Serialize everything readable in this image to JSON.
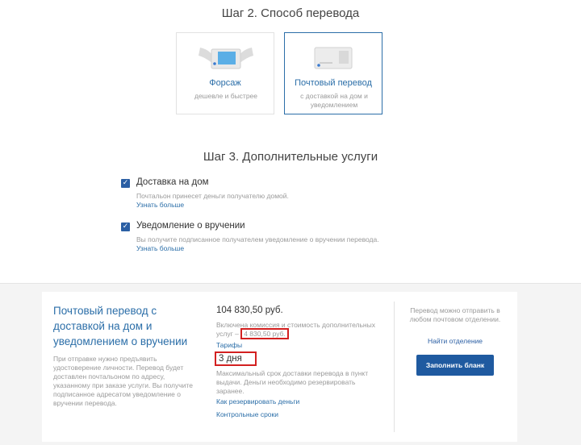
{
  "step2": {
    "title": "Шаг 2. Способ перевода",
    "methods": [
      {
        "title": "Форсаж",
        "subtitle": "дешевле и быстрее",
        "selected": false,
        "icon": "winged-envelope-icon"
      },
      {
        "title": "Почтовый перевод",
        "subtitle": "с доставкой на дом и уведомлением",
        "selected": true,
        "icon": "postal-envelope-icon"
      }
    ]
  },
  "step3": {
    "title": "Шаг 3. Дополнительные услуги",
    "options": [
      {
        "title": "Доставка на дом",
        "desc": "Почтальон принесет деньги получателю домой.",
        "link": "Узнать больше",
        "checked": true
      },
      {
        "title": "Уведомление о вручении",
        "desc": "Вы получите подписанное получателем уведомление о вручении перевода.",
        "link": "Узнать больше",
        "checked": true
      }
    ]
  },
  "summary": {
    "title": "Почтовый перевод с доставкой на дом и уведомлением о вручении",
    "note": "При отправке нужно предъявить удостоверение личности. Перевод будет доставлен почтальоном по адресу, указанному при заказе услуги. Вы получите подписанное адресатом уведомление о вручении перевода.",
    "price": "104 830,50 руб.",
    "commission_text": "Включена комиссия и стоимость дополнительных услуг –",
    "commission_amount": "4 830,50 руб.",
    "tariffs_link": "Тарифы",
    "days": "3 дня",
    "days_desc": "Максимальный срок доставки перевода в пункт выдачи. Деньги необходимо резервировать заранее.",
    "reserve_link": "Как резервировать деньги",
    "deadlines_link": "Контрольные сроки",
    "right_note": "Перевод можно отправить в любом почтовом отделении.",
    "office_link": "Найти отделение",
    "fill_button": "Заполнить бланк"
  },
  "colors": {
    "accent": "#2b6ea8",
    "button": "#1f5aa0",
    "highlight": "#d32020"
  }
}
